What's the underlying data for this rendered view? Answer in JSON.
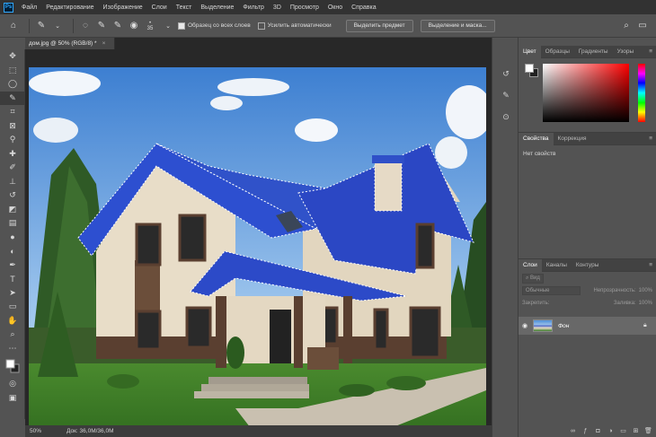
{
  "app": {
    "logo": "Ps"
  },
  "menu": [
    "Файл",
    "Редактирование",
    "Изображение",
    "Слои",
    "Текст",
    "Выделение",
    "Фильтр",
    "3D",
    "Просмотр",
    "Окно",
    "Справка"
  ],
  "options": {
    "brush_size": "35",
    "sample_all_label": "Образец со всех слоев",
    "auto_enhance_label": "Усилить автоматически",
    "select_subject_label": "Выделить предмет",
    "select_mask_label": "Выделение и маска..."
  },
  "document": {
    "tab_title": "дом.jpg @ 50% (RGB/8) *",
    "tab_close": "×",
    "zoom": "50%",
    "doc_size": "Док: 36,0M/36,0M"
  },
  "panels": {
    "color_tabs": [
      "Цвет",
      "Образцы",
      "Градиенты",
      "Узоры"
    ],
    "props_tabs": [
      "Свойства",
      "Коррекция"
    ],
    "props_empty": "Нет свойств",
    "layers_tabs": [
      "Слои",
      "Каналы",
      "Контуры"
    ],
    "layers_kind": "Вид",
    "blend_mode": "Обычные",
    "opacity_label": "Непрозрачность:",
    "opacity_value": "100%",
    "lock_label": "Закрепить:",
    "fill_label": "Заливка:",
    "fill_value": "100%",
    "layer_name": "Фон"
  },
  "colors": {
    "accent": "#31a8ff",
    "sky": "#4f8fd8",
    "roof": "#2f4fc8",
    "wall": "#e8ddc8",
    "grass": "#3c7a2a"
  }
}
